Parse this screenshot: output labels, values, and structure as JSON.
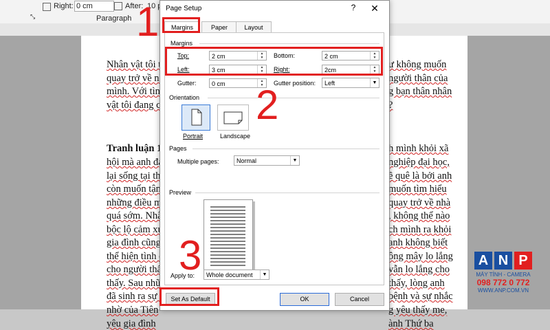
{
  "ribbon": {
    "right_label": "Right:",
    "right_value": "0 cm",
    "after_label": "After:",
    "after_value": "10 p",
    "group_label": "Paragraph"
  },
  "document": {
    "lines": [
      "Nhân vật tôi tr",
      "quay trở về nh",
      "mình. Với tình",
      "vật tôi đang cả",
      "",
      "Tranh luận 1",
      "hội mà anh đạ",
      "lại sống tại thả",
      "còn muốn tận h",
      "những điều ma",
      "quá sớm. Nhâ",
      "bộc lộ cảm xú",
      "gia đình cũng",
      "thể hiện tình c",
      "cho người thấy",
      "thấy. Sau nhữ",
      "đã sinh ra sự l",
      "nhờ của Tiên",
      "yêu gia đình"
    ],
    "right_lines": [
      "ư không muốn",
      "người thân của",
      "g bạn thân nhân",
      "?",
      "",
      "h mình khỏi xã",
      "nghiệp đại học,",
      "ề quê là bởi anh",
      "muốn tìm hiểu",
      "quay trở về nhà",
      ", không thể nào",
      "ch mình ra khỏi",
      "anh không biết",
      "ông mây lo lắng",
      "vẫn lo lắng cho",
      "thấy, lòng anh",
      "bệnh và sự nhắc",
      "g yêu thấy me,",
      "ành  Thứ ba"
    ]
  },
  "dialog": {
    "title": "Page Setup",
    "help": "?",
    "close": "✕",
    "tabs": [
      "Margins",
      "Paper",
      "Layout"
    ],
    "margins_section": "Margins",
    "top_label": "Top:",
    "top_value": "2 cm",
    "bottom_label": "Bottom:",
    "bottom_value": "2 cm",
    "left_label": "Left:",
    "left_value": "3 cm",
    "right_label": "Right:",
    "right_value": "2cm",
    "gutter_label": "Gutter:",
    "gutter_value": "0 cm",
    "gutter_pos_label": "Gutter position:",
    "gutter_pos_value": "Left",
    "orientation_section": "Orientation",
    "portrait": "Portrait",
    "landscape": "Landscape",
    "pages_section": "Pages",
    "multiple_pages_label": "Multiple pages:",
    "multiple_pages_value": "Normal",
    "preview_section": "Preview",
    "apply_to_label": "Apply to:",
    "apply_to_value": "Whole document",
    "set_default": "Set As Default",
    "ok": "OK",
    "cancel": "Cancel"
  },
  "annotations": [
    "1",
    "2",
    "3"
  ],
  "watermark": {
    "letters": [
      "A",
      "N",
      "P"
    ],
    "line1": "MÁY TÍNH - CAMERA",
    "phone": "098 772 0 772",
    "site": "WWW.ANP.COM.VN"
  },
  "colors": {
    "accent": "#e21f1f",
    "brand": "#1a4fa0"
  }
}
